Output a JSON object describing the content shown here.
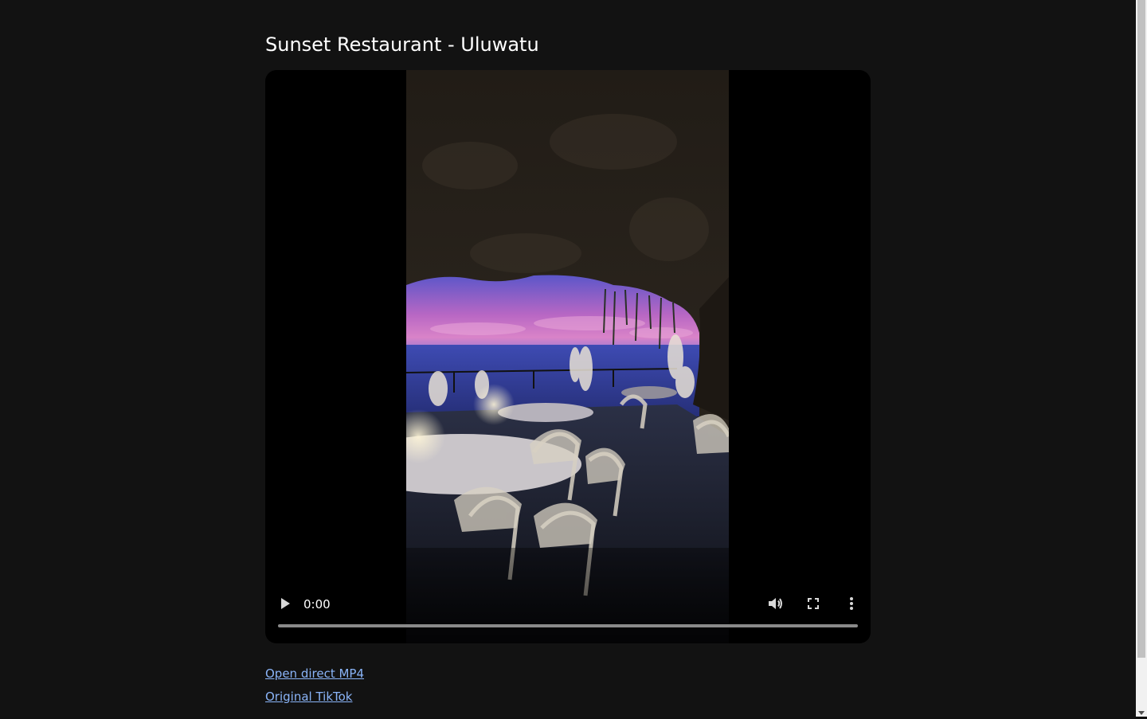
{
  "page": {
    "title": "Sunset Restaurant - Uluwatu"
  },
  "video": {
    "current_time": "0:00",
    "progress_fraction": 0,
    "icons": {
      "play": "play-icon",
      "volume": "volume-icon",
      "fullscreen": "fullscreen-icon",
      "more": "more-vert-icon"
    }
  },
  "links": {
    "mp4": "Open direct MP4",
    "tiktok": "Original TikTok"
  },
  "colors": {
    "background": "#121212",
    "link": "#8ab4f8",
    "player": "#000000"
  }
}
